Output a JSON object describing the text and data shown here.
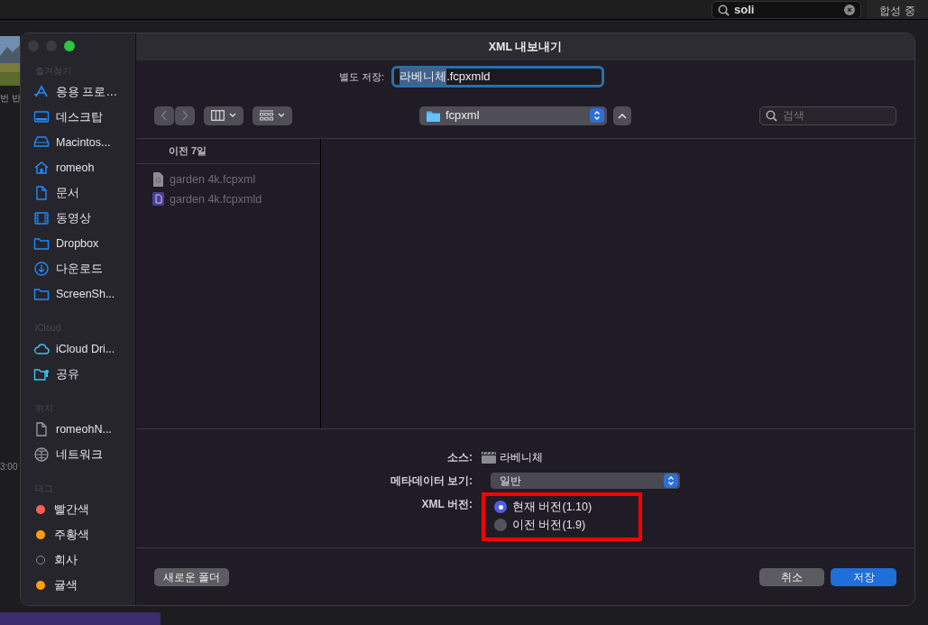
{
  "background_app": {
    "search": {
      "value": "soli"
    },
    "panel_title": "합성 중",
    "left_caption": "번 반",
    "timecode": "3:00"
  },
  "dialog": {
    "title": "XML 내보내기",
    "save_as": {
      "label": "별도 저장:",
      "name_selected": "라베니체",
      "name_rest": ".fcpxmld"
    },
    "location": "fcpxml",
    "search": {
      "placeholder": "검색"
    },
    "sidebar": [
      {
        "heading": "즐겨찾기",
        "items": [
          {
            "label": "응용 프로…"
          },
          {
            "label": "데스크탑"
          },
          {
            "label": "Macintos..."
          },
          {
            "label": "romeoh"
          },
          {
            "label": "문서"
          },
          {
            "label": "동영상"
          },
          {
            "label": "Dropbox"
          },
          {
            "label": "다운로드"
          },
          {
            "label": "ScreenSh..."
          }
        ]
      },
      {
        "heading": "iCloud",
        "items": [
          {
            "label": "iCloud Dri..."
          },
          {
            "label": "공유"
          }
        ]
      },
      {
        "heading": "위치",
        "items": [
          {
            "label": "romeohN..."
          },
          {
            "label": "네트워크"
          }
        ]
      },
      {
        "heading": "태그",
        "items": [
          {
            "label": "빨간색",
            "color": "#ff5f57"
          },
          {
            "label": "주황색",
            "color": "#ff9f0a"
          },
          {
            "label": "회사"
          },
          {
            "label": "귤색",
            "color": "#ff9f0a"
          }
        ]
      }
    ],
    "browser": {
      "column_header": "이전 7일",
      "files": [
        {
          "name": "garden 4k.fcpxml",
          "kind": "document"
        },
        {
          "name": "garden 4k.fcpxmld",
          "kind": "bundle"
        }
      ]
    },
    "options": {
      "source_label": "소스:",
      "source_value": "라베니체",
      "metadata_label": "메타데이터 보기:",
      "metadata_value": "일반",
      "version_label": "XML 버전:",
      "version_highlighted": true,
      "versions": [
        {
          "label": "현재 버전(1.10)",
          "selected": true
        },
        {
          "label": "이전 버전(1.9)",
          "selected": false
        }
      ]
    },
    "buttons": {
      "new_folder": "새로운 폴더",
      "cancel": "취소",
      "save": "저장"
    }
  }
}
